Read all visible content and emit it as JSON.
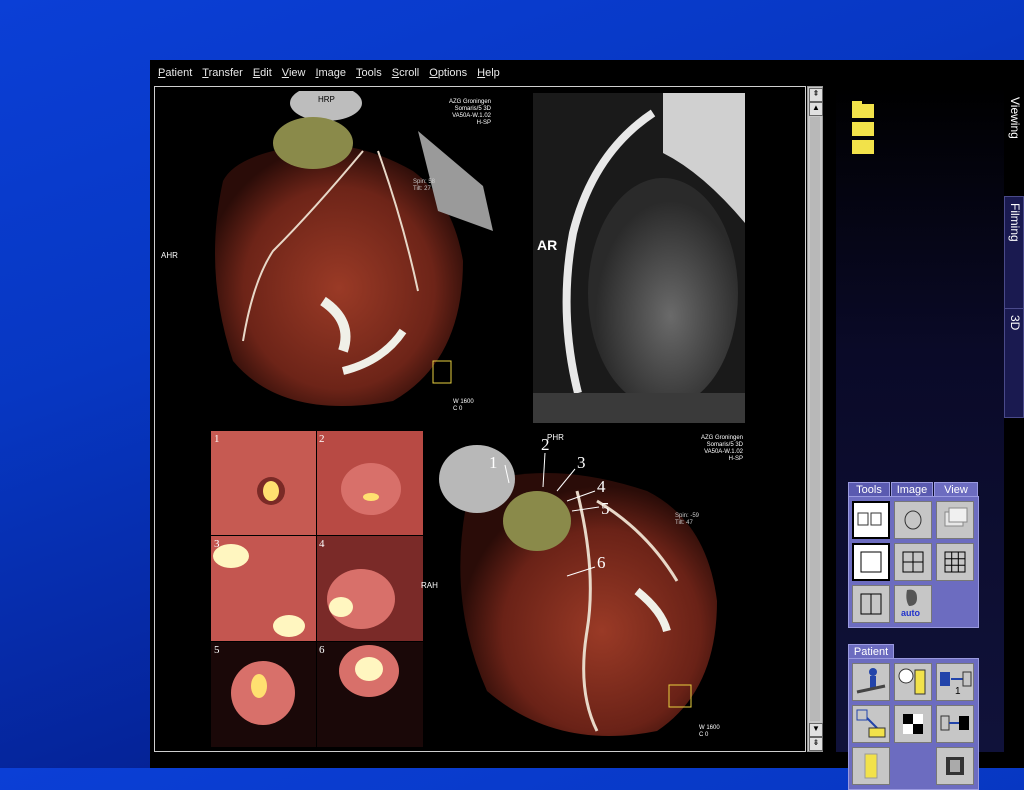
{
  "menu": [
    {
      "underline": "P",
      "rest": "atient"
    },
    {
      "underline": "T",
      "rest": "ransfer"
    },
    {
      "underline": "E",
      "rest": "dit"
    },
    {
      "underline": "V",
      "rest": "iew"
    },
    {
      "underline": "I",
      "rest": "mage"
    },
    {
      "underline": "T",
      "rest": "ools"
    },
    {
      "underline": "S",
      "rest": "croll"
    },
    {
      "underline": "O",
      "rest": "ptions"
    },
    {
      "underline": "H",
      "rest": "elp"
    }
  ],
  "viewer": {
    "top_left": {
      "top_label": "HRP",
      "side_label": "AHR",
      "info": [
        "AZG Groningen",
        "Somaris/5 3D",
        "VA50A-W.1.02",
        "H-SP"
      ],
      "spin_tilt": [
        "Spin: 58",
        "Tilt: 27"
      ],
      "window": [
        "W 1600",
        "C      0"
      ]
    },
    "top_right": {
      "label": "AR"
    },
    "bottom_left": {
      "quad_numbers": [
        "1",
        "2",
        "3",
        "4",
        "5",
        "6"
      ]
    },
    "bottom_right": {
      "top_label": "PHR",
      "side_label": "RAH",
      "info": [
        "AZG Groningen",
        "Somaris/5 3D",
        "VA50A-W.1.02",
        "H-SP"
      ],
      "spin_tilt": [
        "Spin: -59",
        "Tilt: 47"
      ],
      "window": [
        "W 1600",
        "C      0"
      ],
      "numbers": [
        "1",
        "2",
        "3",
        "4",
        "5",
        "6"
      ]
    }
  },
  "side_tabs": [
    "Viewing",
    "Filming",
    "3D"
  ],
  "tools_panel": {
    "tabs": [
      "Tools",
      "Image",
      "View"
    ],
    "auto_label": "auto"
  },
  "patient_panel": {
    "tab": "Patient",
    "tile_digit": "1"
  },
  "colors": {
    "background": "#0737c2",
    "panel": "#6c6cc0",
    "folder": "#f2e24a"
  },
  "icons": [
    "folder-icon",
    "layout-1x1-icon",
    "layout-2x2-icon",
    "layout-3x3-icon",
    "auto-layout-icon"
  ]
}
